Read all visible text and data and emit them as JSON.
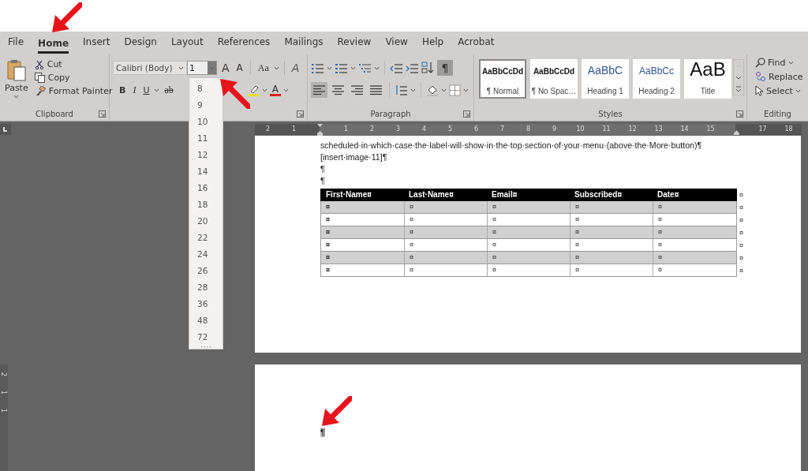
{
  "menu_tabs": [
    {
      "label": "File",
      "selected": false
    },
    {
      "label": "Home",
      "selected": true
    },
    {
      "label": "Insert",
      "selected": false
    },
    {
      "label": "Design",
      "selected": false
    },
    {
      "label": "Layout",
      "selected": false
    },
    {
      "label": "References",
      "selected": false
    },
    {
      "label": "Mailings",
      "selected": false
    },
    {
      "label": "Review",
      "selected": false
    },
    {
      "label": "View",
      "selected": false
    },
    {
      "label": "Help",
      "selected": false
    },
    {
      "label": "Acrobat",
      "selected": false
    }
  ],
  "ribbon": {
    "clipboard": {
      "paste": "Paste",
      "cut": "Cut",
      "copy": "Copy",
      "format_painter": "Format Painter",
      "label": "Clipboard"
    },
    "font": {
      "font_name": "Calibri (Body)",
      "font_size": "1",
      "grow": "A",
      "shrink": "A",
      "change_case": "Aa",
      "clear_formatting": "A",
      "format_buttons": [
        {
          "kind": "bold",
          "label": "B"
        },
        {
          "kind": "italic",
          "label": "I"
        },
        {
          "kind": "underline",
          "label": "U"
        },
        {
          "kind": "strikethrough",
          "label": "ab"
        }
      ],
      "font_color": "A"
    },
    "paragraph": {
      "label": "Paragraph",
      "show_marks": {
        "label": "¶",
        "selected": true
      },
      "alignment_buttons": [
        {
          "kind": "left",
          "selected": true
        },
        {
          "kind": "center",
          "selected": false
        },
        {
          "kind": "right",
          "selected": false
        },
        {
          "kind": "justify",
          "selected": false
        }
      ]
    },
    "styles": {
      "label": "Styles",
      "items": [
        {
          "preview": "AaBbCcDd",
          "name": "¶ Normal",
          "kind": "normal",
          "selected": true
        },
        {
          "preview": "AaBbCcDd",
          "name": "¶ No Spac…",
          "kind": "normal",
          "selected": false
        },
        {
          "preview": "AaBbC",
          "name": "Heading 1",
          "kind": "heading",
          "selected": false
        },
        {
          "preview": "AaBbCc",
          "name": "Heading 2",
          "kind": "heading2",
          "selected": false
        },
        {
          "preview": "AaB",
          "name": "Title",
          "kind": "title",
          "selected": false
        }
      ]
    },
    "editing": {
      "label": "Editing",
      "find": "Find",
      "replace": "Replace",
      "select": "Select"
    }
  },
  "font_size_list": [
    "8",
    "9",
    "10",
    "11",
    "12",
    "14",
    "16",
    "18",
    "20",
    "22",
    "24",
    "26",
    "28",
    "36",
    "48",
    "72"
  ],
  "rulers": {
    "horizontal": [
      {
        "kind": "number",
        "label": "2"
      },
      {
        "kind": "number",
        "label": "1"
      },
      {
        "kind": "indent"
      },
      {
        "kind": "number",
        "label": "1"
      },
      {
        "kind": "number",
        "label": "2"
      },
      {
        "kind": "number",
        "label": "3"
      },
      {
        "kind": "number",
        "label": "4"
      },
      {
        "kind": "number",
        "label": "5"
      },
      {
        "kind": "number",
        "label": "6"
      },
      {
        "kind": "number",
        "label": "7"
      },
      {
        "kind": "number",
        "label": "8"
      },
      {
        "kind": "number",
        "label": "9"
      },
      {
        "kind": "number",
        "label": "10"
      },
      {
        "kind": "number",
        "label": "11"
      },
      {
        "kind": "number",
        "label": "12"
      },
      {
        "kind": "number",
        "label": "13"
      },
      {
        "kind": "number",
        "label": "14"
      },
      {
        "kind": "number",
        "label": "15"
      },
      {
        "kind": "margin"
      },
      {
        "kind": "number",
        "label": "17"
      },
      {
        "kind": "number",
        "label": "18"
      }
    ],
    "vertical": [
      "2",
      "1",
      "1"
    ]
  },
  "document": {
    "page_1": {
      "paragraphs": [
        "scheduled·in·which·case·the·label·will·show·in·the·top·section·of·your·menu·(above·the·More·button)¶",
        "[insert·image·11]¶",
        "¶",
        "¶"
      ],
      "table": {
        "columns": [
          "First·Name¤",
          "Last·Name¤",
          "Email¤",
          "Subscribed¤",
          "Date¤"
        ],
        "header_end_mark": "¤",
        "rows": [
          {
            "banded": true,
            "cells": [
              "¤",
              "¤",
              "¤",
              "¤",
              "¤"
            ],
            "end_mark": "¤"
          },
          {
            "banded": false,
            "cells": [
              "¤",
              "¤",
              "¤",
              "¤",
              "¤"
            ],
            "end_mark": "¤"
          },
          {
            "banded": true,
            "cells": [
              "¤",
              "¤",
              "¤",
              "¤",
              "¤"
            ],
            "end_mark": "¤"
          },
          {
            "banded": false,
            "cells": [
              "¤",
              "¤",
              "¤",
              "¤",
              "¤"
            ],
            "end_mark": "¤"
          },
          {
            "banded": true,
            "cells": [
              "¤",
              "¤",
              "¤",
              "¤",
              "¤"
            ],
            "end_mark": "¤"
          },
          {
            "banded": false,
            "cells": [
              "¤",
              "¤",
              "¤",
              "¤",
              "¤"
            ],
            "end_mark": "¤"
          }
        ]
      }
    },
    "page_2": {
      "paragraphs": [
        {
          "text": "¶",
          "highlighted": true
        }
      ]
    }
  }
}
